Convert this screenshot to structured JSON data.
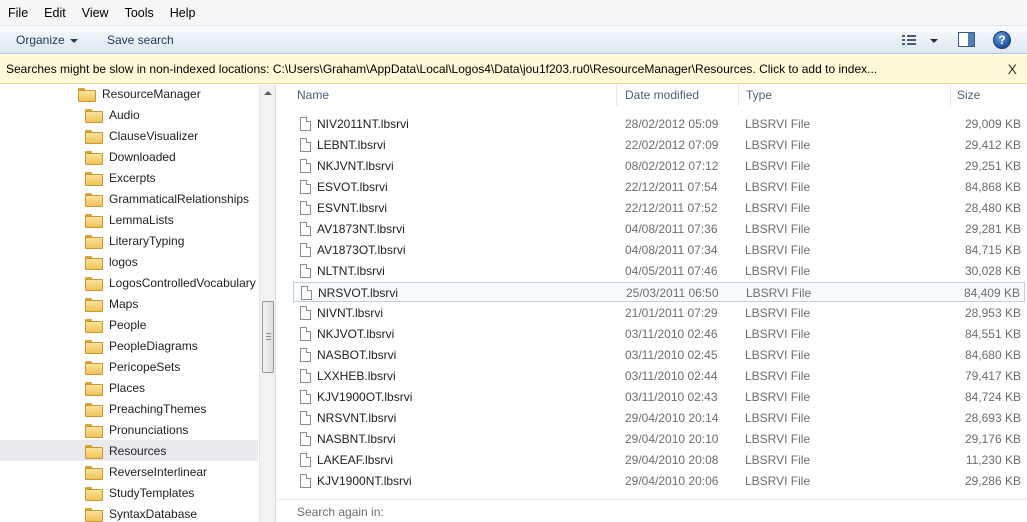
{
  "menu": [
    "File",
    "Edit",
    "View",
    "Tools",
    "Help"
  ],
  "toolbar": {
    "organize_label": "Organize",
    "save_search_label": "Save search",
    "help_label": "?"
  },
  "infobar": {
    "message": "Searches might be slow in non-indexed locations: C:\\Users\\Graham\\AppData\\Local\\Logos4\\Data\\jou1f203.ru0\\ResourceManager\\Resources. Click to add to index...",
    "close_label": "X"
  },
  "nav": {
    "parent": "ResourceManager",
    "folders": [
      "Audio",
      "ClauseVisualizer",
      "Downloaded",
      "Excerpts",
      "GrammaticalRelationships",
      "LemmaLists",
      "LiteraryTyping",
      "logos",
      "LogosControlledVocabulary",
      "Maps",
      "People",
      "PeopleDiagrams",
      "PericopeSets",
      "Places",
      "PreachingThemes",
      "Pronunciations",
      "Resources",
      "ReverseInterlinear",
      "StudyTemplates",
      "SyntaxDatabase"
    ],
    "selected": "Resources"
  },
  "columns": {
    "name": "Name",
    "date": "Date modified",
    "type": "Type",
    "size": "Size"
  },
  "files": [
    {
      "name": "NIV2011NT.lbsrvi",
      "date": "28/02/2012 05:09",
      "type": "LBSRVI File",
      "size": "29,009 KB"
    },
    {
      "name": "LEBNT.lbsrvi",
      "date": "22/02/2012 07:09",
      "type": "LBSRVI File",
      "size": "29,412 KB"
    },
    {
      "name": "NKJVNT.lbsrvi",
      "date": "08/02/2012 07:12",
      "type": "LBSRVI File",
      "size": "29,251 KB"
    },
    {
      "name": "ESVOT.lbsrvi",
      "date": "22/12/2011 07:54",
      "type": "LBSRVI File",
      "size": "84,868 KB"
    },
    {
      "name": "ESVNT.lbsrvi",
      "date": "22/12/2011 07:52",
      "type": "LBSRVI File",
      "size": "28,480 KB"
    },
    {
      "name": "AV1873NT.lbsrvi",
      "date": "04/08/2011 07:36",
      "type": "LBSRVI File",
      "size": "29,281 KB"
    },
    {
      "name": "AV1873OT.lbsrvi",
      "date": "04/08/2011 07:34",
      "type": "LBSRVI File",
      "size": "84,715 KB"
    },
    {
      "name": "NLTNT.lbsrvi",
      "date": "04/05/2011 07:46",
      "type": "LBSRVI File",
      "size": "30,028 KB"
    },
    {
      "name": "NRSVOT.lbsrvi",
      "date": "25/03/2011 06:50",
      "type": "LBSRVI File",
      "size": "84,409 KB"
    },
    {
      "name": "NIVNT.lbsrvi",
      "date": "21/01/2011 07:29",
      "type": "LBSRVI File",
      "size": "28,953 KB"
    },
    {
      "name": "NKJVOT.lbsrvi",
      "date": "03/11/2010 02:46",
      "type": "LBSRVI File",
      "size": "84,551 KB"
    },
    {
      "name": "NASBOT.lbsrvi",
      "date": "03/11/2010 02:45",
      "type": "LBSRVI File",
      "size": "84,680 KB"
    },
    {
      "name": "LXXHEB.lbsrvi",
      "date": "03/11/2010 02:44",
      "type": "LBSRVI File",
      "size": "79,417 KB"
    },
    {
      "name": "KJV1900OT.lbsrvi",
      "date": "03/11/2010 02:43",
      "type": "LBSRVI File",
      "size": "84,724 KB"
    },
    {
      "name": "NRSVNT.lbsrvi",
      "date": "29/04/2010 20:14",
      "type": "LBSRVI File",
      "size": "28,693 KB"
    },
    {
      "name": "NASBNT.lbsrvi",
      "date": "29/04/2010 20:10",
      "type": "LBSRVI File",
      "size": "29,176 KB"
    },
    {
      "name": "LAKEAF.lbsrvi",
      "date": "29/04/2010 20:08",
      "type": "LBSRVI File",
      "size": "11,230 KB"
    },
    {
      "name": "KJV1900NT.lbsrvi",
      "date": "29/04/2010 20:06",
      "type": "LBSRVI File",
      "size": "29,286 KB"
    }
  ],
  "focused_file": "NRSVOT.lbsrvi",
  "search_again_label": "Search again in:"
}
